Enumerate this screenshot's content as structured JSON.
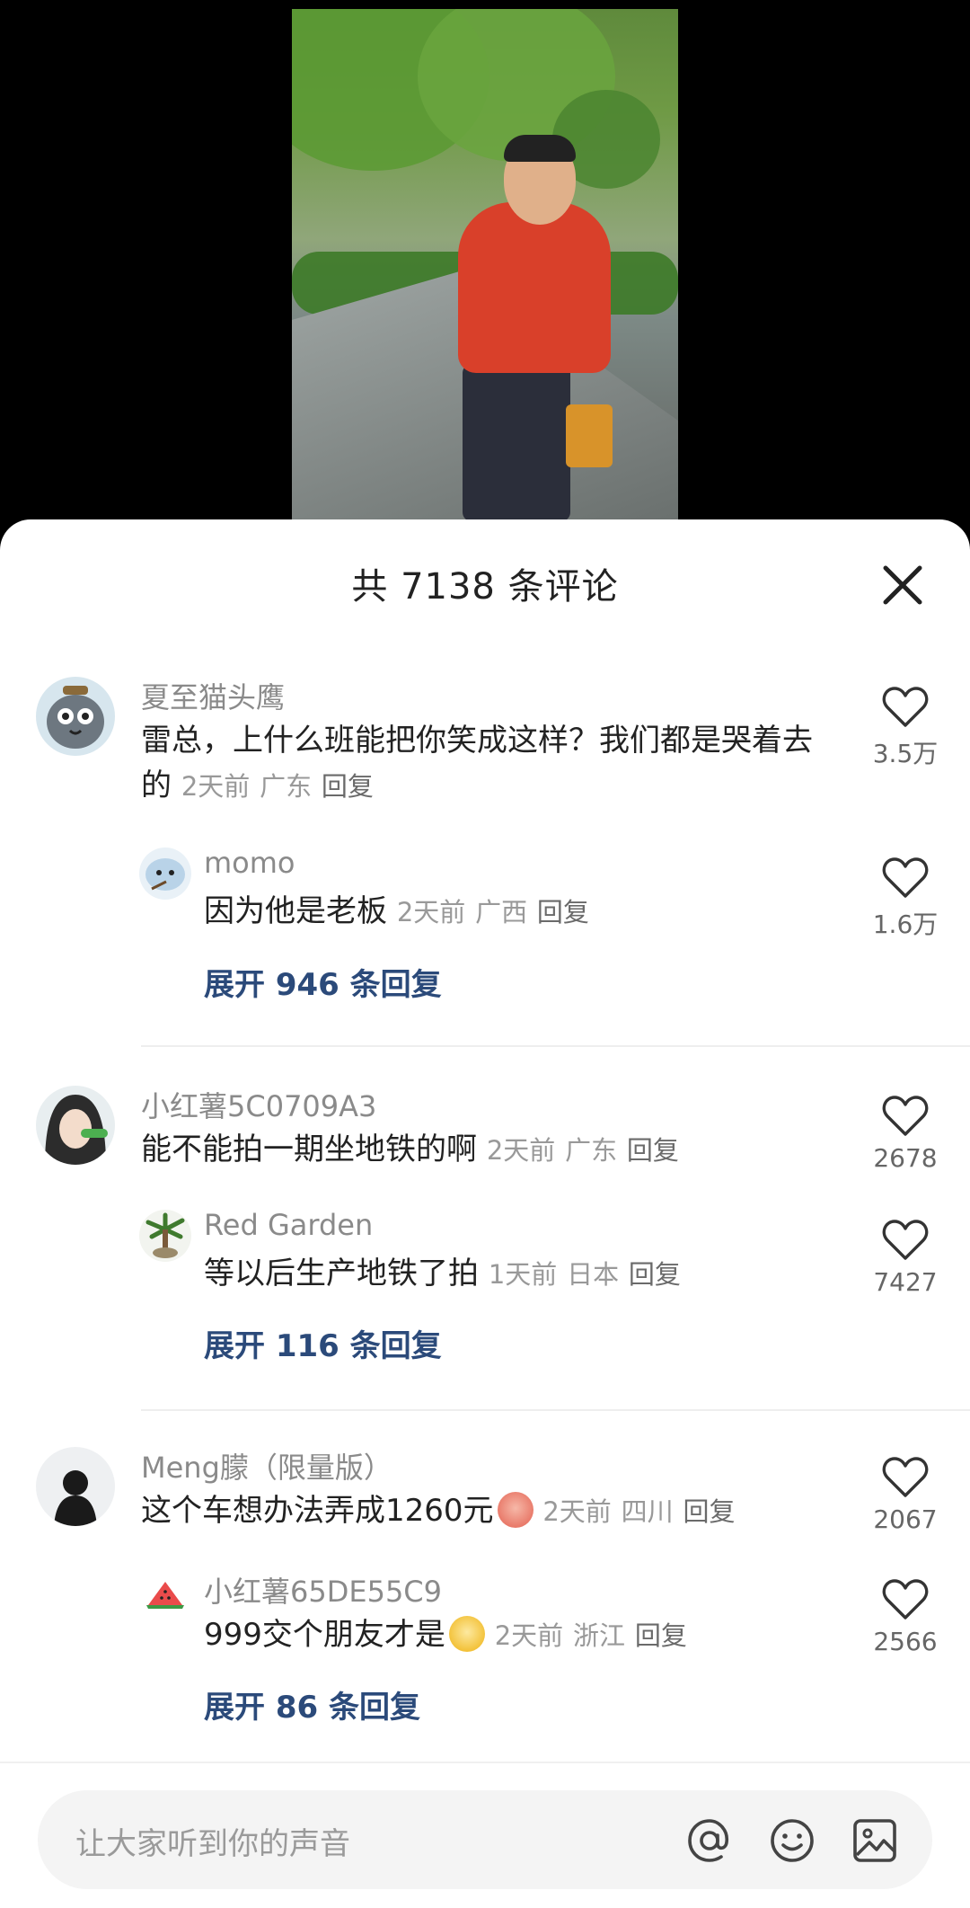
{
  "sheet": {
    "title": "共 7138 条评论"
  },
  "comments": [
    {
      "username": "夏至猫头鹰",
      "text": "雷总，上什么班能把你笑成这样？我们都是哭着去的",
      "time": "2天前",
      "location": "广东",
      "reply": "回复",
      "likes": "3.5万",
      "avatar_icon": "owl-avatar",
      "sub": {
        "username": "momo",
        "text": "因为他是老板",
        "time": "2天前",
        "location": "广西",
        "reply": "回复",
        "likes": "1.6万",
        "avatar_icon": "cartoon-avatar"
      },
      "expand": "展开 946 条回复"
    },
    {
      "username": "小红薯5C0709A3",
      "text": "能不能拍一期坐地铁的啊",
      "time": "2天前",
      "location": "广东",
      "reply": "回复",
      "likes": "2678",
      "avatar_icon": "anime-girl-avatar",
      "sub": {
        "username": "Red Garden",
        "text": "等以后生产地铁了拍",
        "time": "1天前",
        "location": "日本",
        "reply": "回复",
        "likes": "7427",
        "avatar_icon": "palm-tree-avatar"
      },
      "expand": "展开 116 条回复"
    },
    {
      "username": "Meng朦（限量版）",
      "text": "这个车想办法弄成1260元",
      "time": "2天前",
      "location": "四川",
      "reply": "回复",
      "likes": "2067",
      "avatar_icon": "silhouette-avatar",
      "sub": {
        "username": "小红薯65DE55C9",
        "text": "999交个朋友才是",
        "time": "2天前",
        "location": "浙江",
        "reply": "回复",
        "likes": "2566",
        "avatar_icon": "watermelon-avatar"
      },
      "expand": "展开 86 条回复"
    }
  ],
  "input": {
    "placeholder": "让大家听到你的声音"
  },
  "colors": {
    "expand_link": "#2b4a7a",
    "meta_gray": "#999999"
  }
}
